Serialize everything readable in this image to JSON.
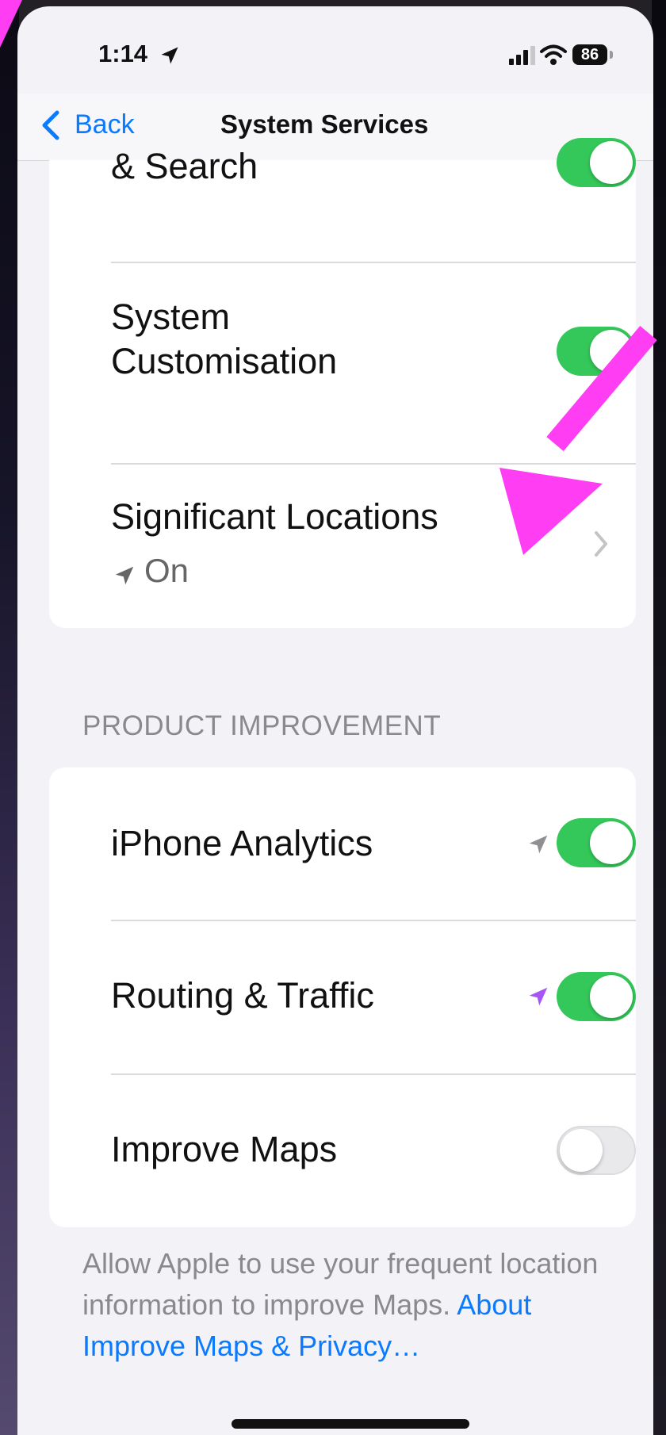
{
  "status_bar": {
    "time": "1:14",
    "battery_level": "86"
  },
  "nav": {
    "back_label": "Back",
    "title": "System Services"
  },
  "top_group": {
    "items": [
      {
        "label": "& Search",
        "toggle_on": true
      },
      {
        "label": "System\nCustomisation",
        "toggle_on": true
      },
      {
        "label": "Significant Locations",
        "value": "On"
      }
    ]
  },
  "product_improvement": {
    "header": "PRODUCT IMPROVEMENT",
    "items": [
      {
        "label": "iPhone Analytics",
        "toggle_on": true,
        "location_icon_color": "#8e8e93"
      },
      {
        "label": "Routing & Traffic",
        "toggle_on": true,
        "location_icon_color": "#a855f7"
      },
      {
        "label": "Improve Maps",
        "toggle_on": false
      }
    ],
    "footer_text": "Allow Apple to use your frequent location information to improve Maps.",
    "footer_link": "About Improve Maps & Privacy…"
  },
  "colors": {
    "accent": "#0a7aff",
    "toggle_on": "#34c759",
    "annotation": "#ff3df2"
  }
}
